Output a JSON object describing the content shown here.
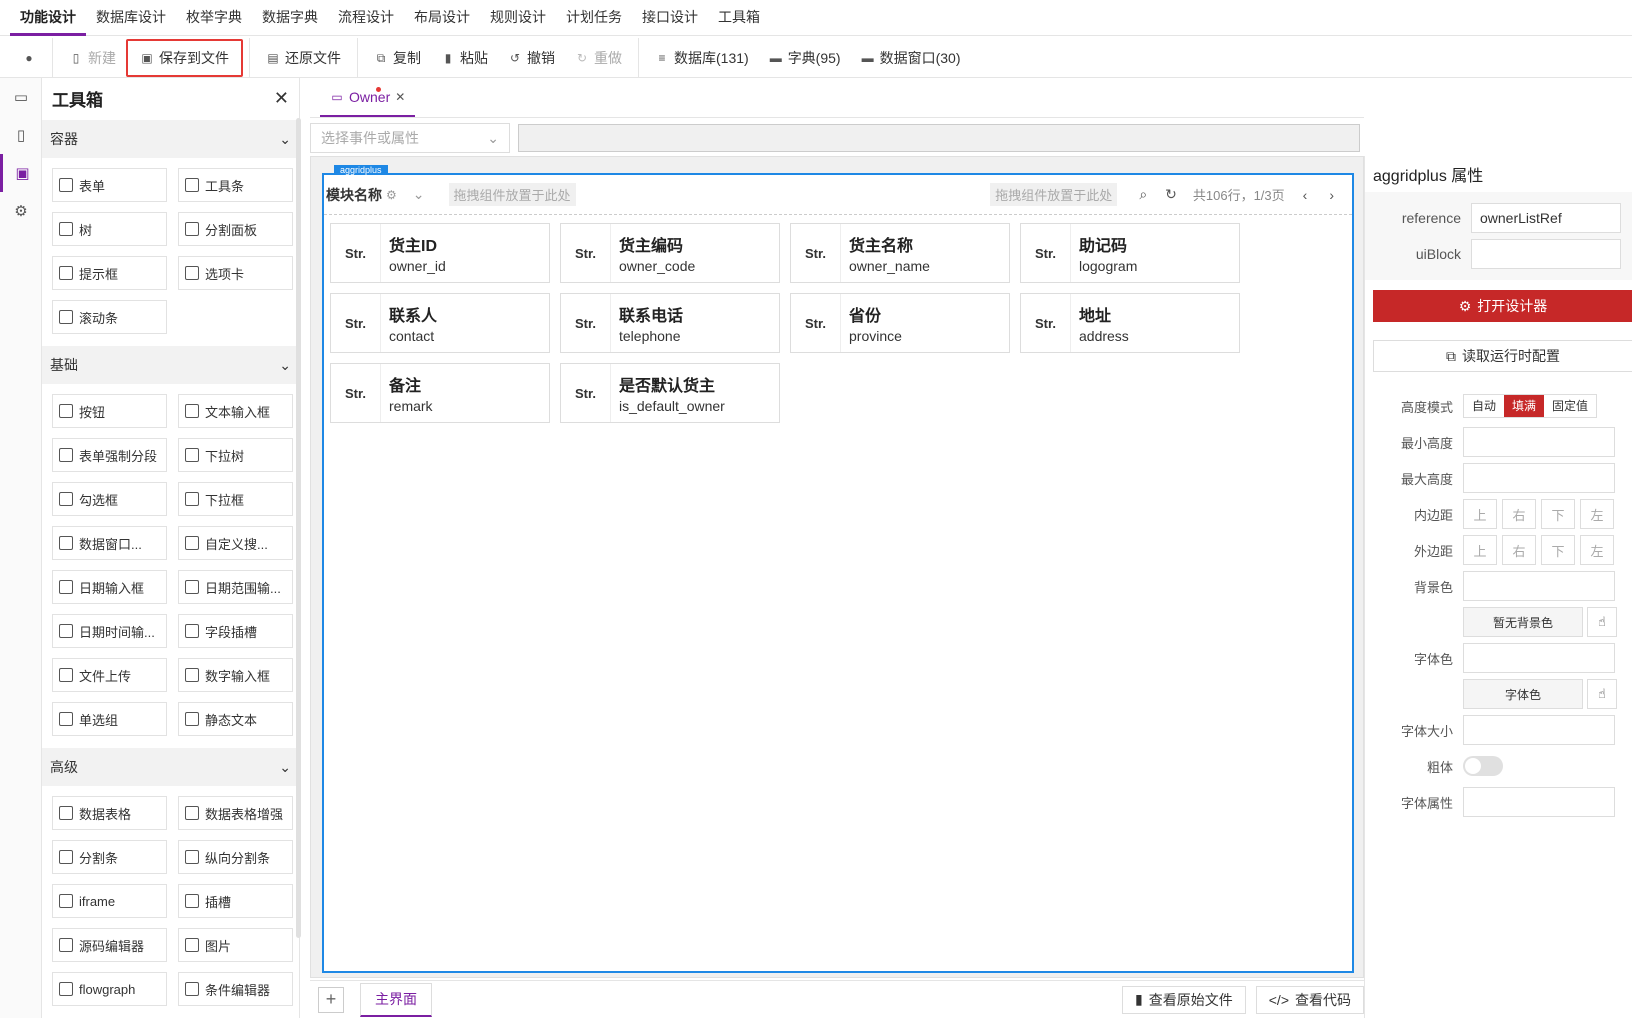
{
  "menu": [
    "功能设计",
    "数据库设计",
    "枚举字典",
    "数据字典",
    "流程设计",
    "布局设计",
    "规则设计",
    "计划任务",
    "接口设计",
    "工具箱"
  ],
  "toolbar": {
    "new": "新建",
    "save": "保存到文件",
    "restore": "还原文件",
    "copy": "复制",
    "paste": "粘贴",
    "undo": "撤销",
    "redo": "重做",
    "db": "数据库(131)",
    "dict": "字典(95)",
    "dw": "数据窗口(30)"
  },
  "toolbox": {
    "title": "工具箱",
    "sections": [
      {
        "name": "容器",
        "items": [
          "表单",
          "工具条",
          "树",
          "分割面板",
          "提示框",
          "选项卡",
          "滚动条"
        ]
      },
      {
        "name": "基础",
        "items": [
          "按钮",
          "文本输入框",
          "表单强制分段",
          "下拉树",
          "勾选框",
          "下拉框",
          "数据窗口...",
          "自定义搜...",
          "日期输入框",
          "日期范围输...",
          "日期时间输...",
          "字段插槽",
          "文件上传",
          "数字输入框",
          "单选组",
          "静态文本"
        ]
      },
      {
        "name": "高级",
        "items": [
          "数据表格",
          "数据表格增强",
          "分割条",
          "纵向分割条",
          "iframe",
          "插槽",
          "源码编辑器",
          "图片",
          "flowgraph",
          "条件编辑器"
        ]
      }
    ]
  },
  "tab": {
    "name": "Owner"
  },
  "event": {
    "placeholder": "选择事件或属性"
  },
  "grid": {
    "tag": "aggridplus",
    "module": "模块名称",
    "drop1": "拖拽组件放置于此处",
    "drop2": "拖拽组件放置于此处",
    "pager": "共106行，1/3页",
    "cards": [
      {
        "type": "Str.",
        "label": "货主ID",
        "field": "owner_id"
      },
      {
        "type": "Str.",
        "label": "货主编码",
        "field": "owner_code"
      },
      {
        "type": "Str.",
        "label": "货主名称",
        "field": "owner_name"
      },
      {
        "type": "Str.",
        "label": "助记码",
        "field": "logogram"
      },
      {
        "type": "Str.",
        "label": "联系人",
        "field": "contact"
      },
      {
        "type": "Str.",
        "label": "联系电话",
        "field": "telephone"
      },
      {
        "type": "Str.",
        "label": "省份",
        "field": "province"
      },
      {
        "type": "Str.",
        "label": "地址",
        "field": "address"
      },
      {
        "type": "Str.",
        "label": "备注",
        "field": "remark"
      },
      {
        "type": "Str.",
        "label": "是否默认货主",
        "field": "is_default_owner"
      }
    ]
  },
  "bottom": {
    "page": "主界面",
    "source": "查看原始文件",
    "code": "查看代码"
  },
  "props": {
    "title": "aggridplus 属性",
    "reference_label": "reference",
    "reference": "ownerListRef",
    "uiblock_label": "uiBlock",
    "open_designer": "打开设计器",
    "read_config": "读取运行时配置",
    "height_mode": "高度模式",
    "modes": [
      "自动",
      "填满",
      "固定值"
    ],
    "min_h": "最小高度",
    "max_h": "最大高度",
    "padding": "内边距",
    "margin": "外边距",
    "sides": [
      "上",
      "右",
      "下",
      "左"
    ],
    "bg": "背景色",
    "no_bg": "暂无背景色",
    "fg": "字体色",
    "fg_btn": "字体色",
    "fsize": "字体大小",
    "bold": "粗体",
    "fattr": "字体属性"
  }
}
